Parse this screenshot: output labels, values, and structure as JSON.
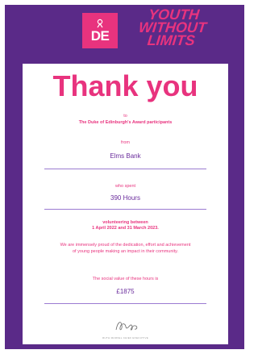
{
  "header": {
    "logo_text": "DE",
    "slogan_lines": [
      "YOUTH",
      "WITHOUT",
      "LIMITS"
    ]
  },
  "certificate": {
    "title": "Thank you",
    "to_label": "to",
    "recipient": "The Duke of Edinburgh's Award participants",
    "from_label": "from",
    "organisation": "Elms Bank",
    "who_spent_label": "who spent",
    "hours": "390 Hours",
    "volunteering_line1": "volunteering between",
    "volunteering_line2": "1 April 2022 and 31 March 2023.",
    "message_line1": "We are immensely proud of the dedication, effort and achievement",
    "message_line2": "of young people making an impact in their community.",
    "social_value_label": "The social value of these hours is",
    "social_value": "£1875",
    "signatory": "RUTH MARVEL CHIEF EXECUTIVE"
  },
  "colors": {
    "frame": "#5a2a88",
    "brand_pink": "#e8337e",
    "value_purple": "#6a2c9c",
    "rule": "#9b7bd1"
  }
}
